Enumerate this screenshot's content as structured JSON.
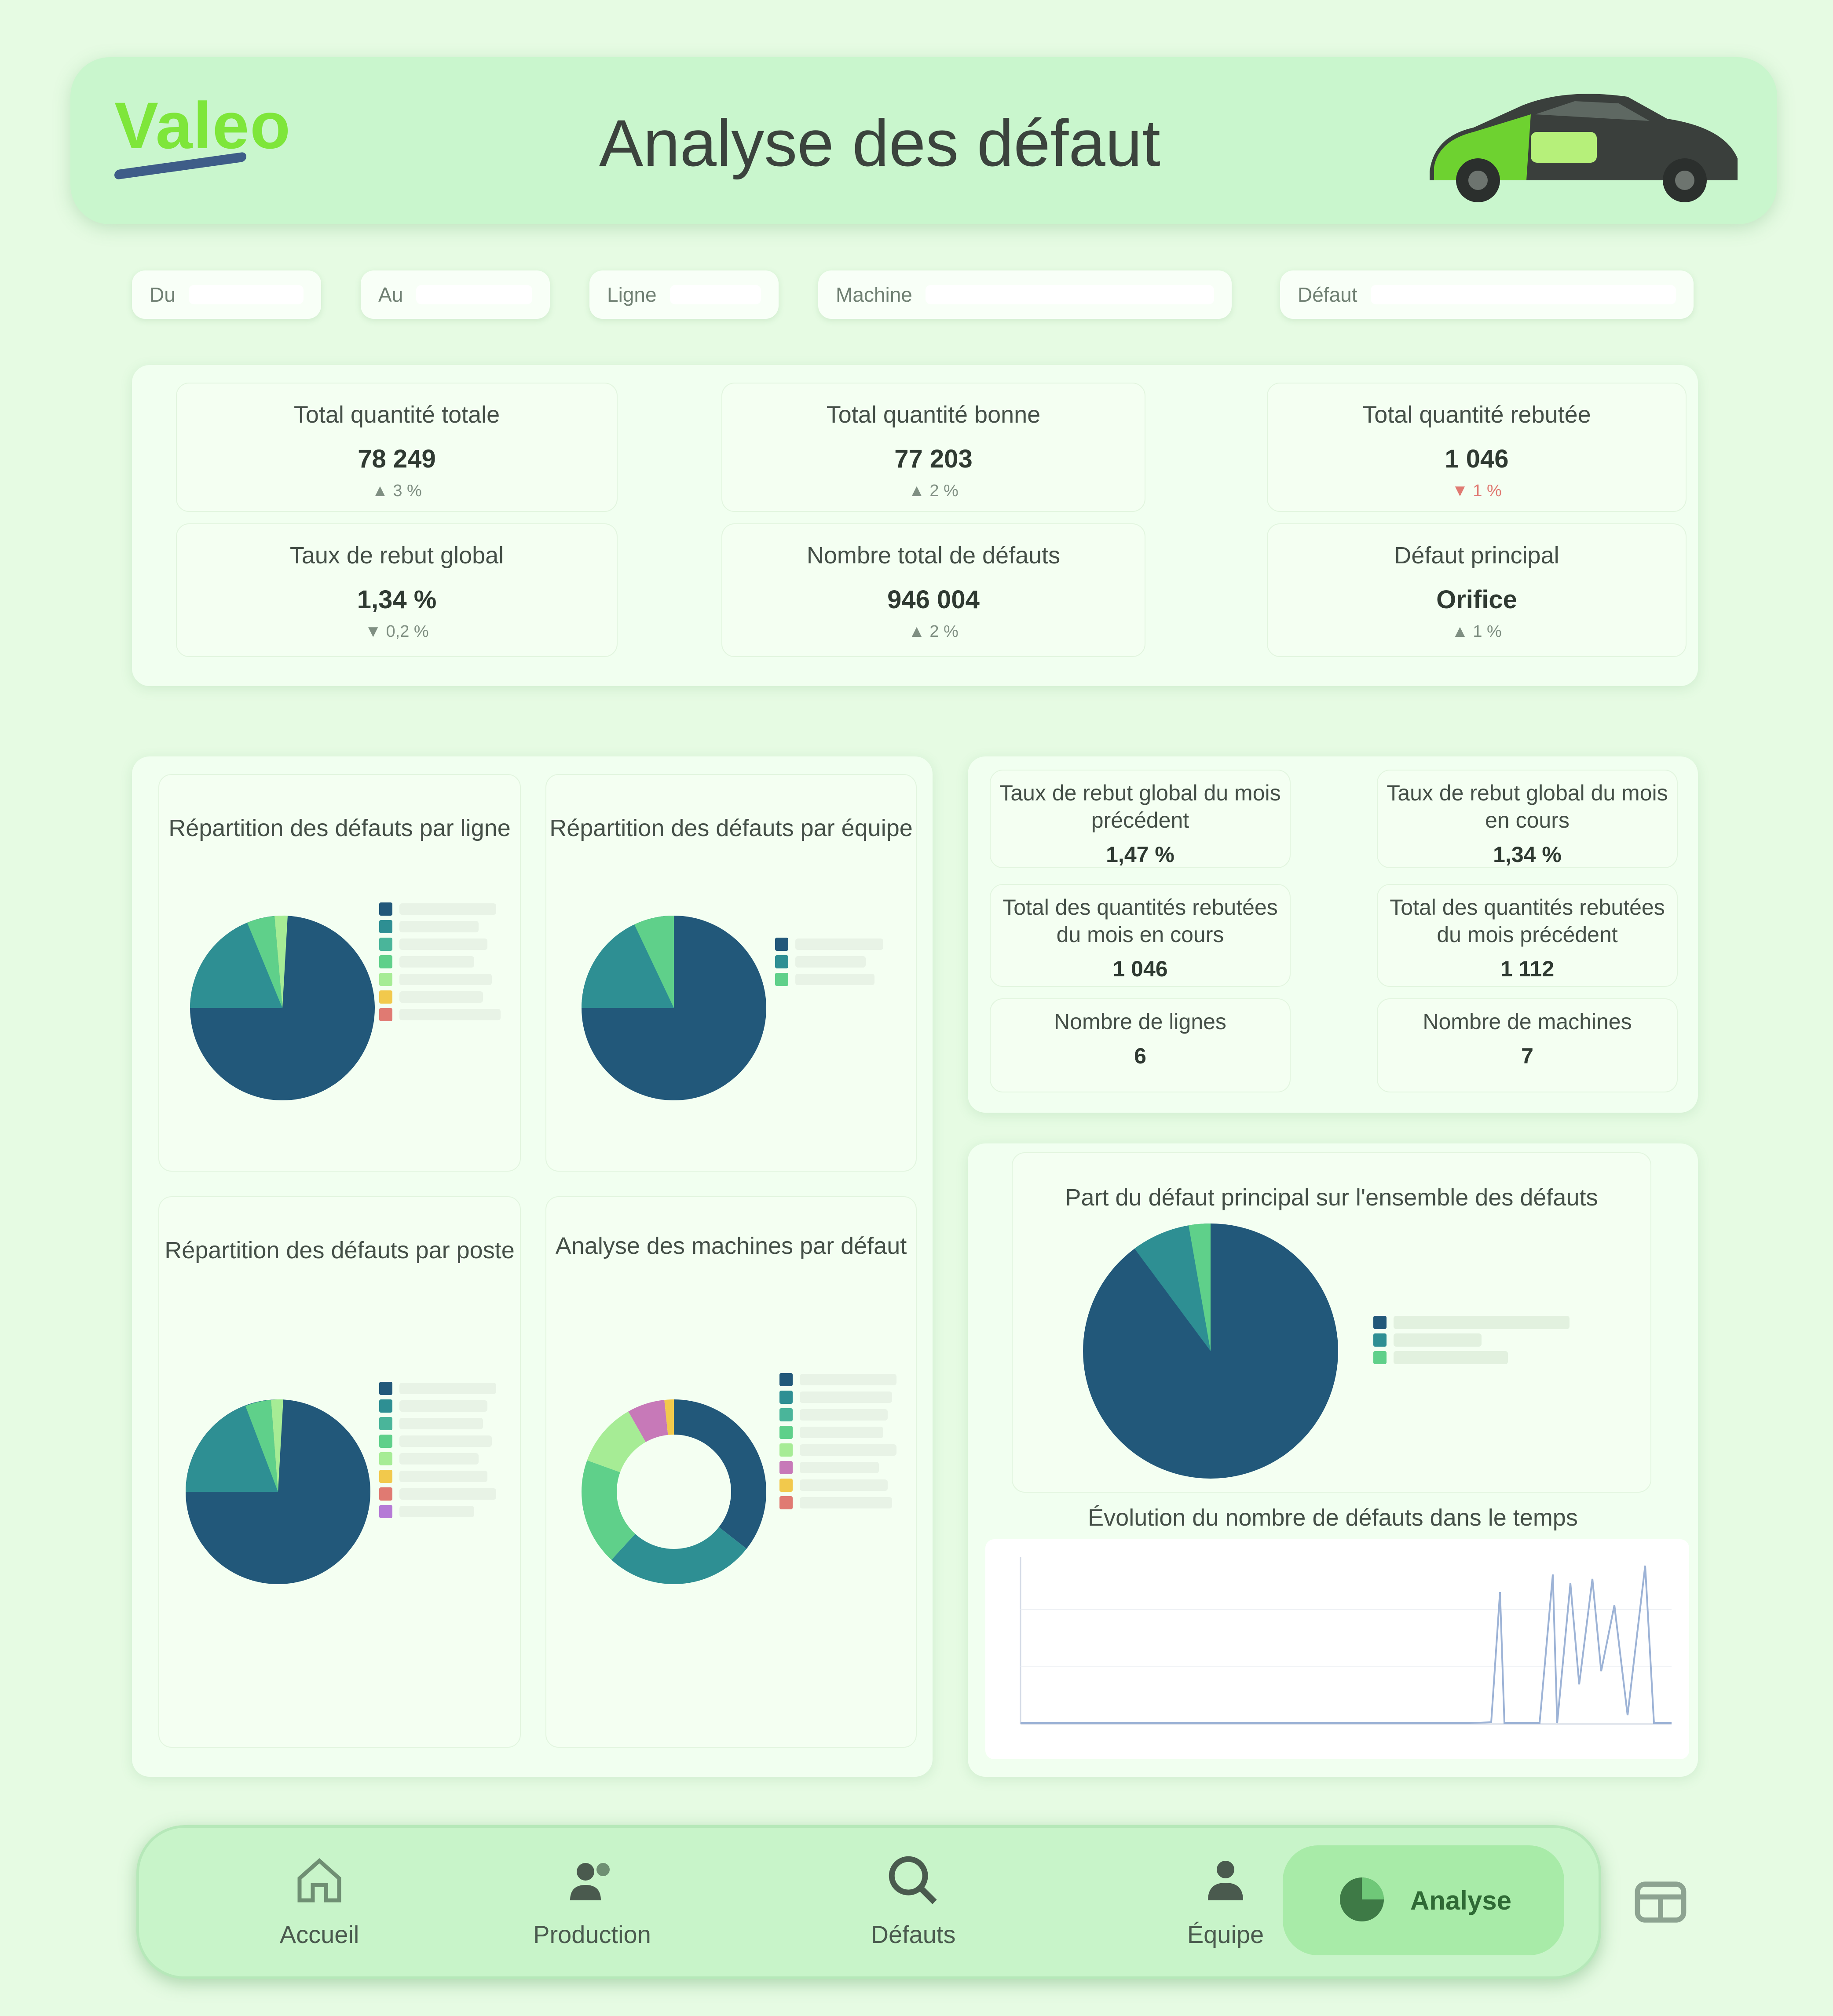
{
  "header": {
    "brand": "Valeo",
    "title": "Analyse des défaut"
  },
  "filters": [
    {
      "label": "Du"
    },
    {
      "label": "Au"
    },
    {
      "label": "Ligne"
    },
    {
      "label": "Machine"
    },
    {
      "label": "Défaut"
    }
  ],
  "kpis": [
    {
      "label": "Total quantité totale",
      "value": "78 249",
      "trend": "▲ 3 %"
    },
    {
      "label": "Total quantité bonne",
      "value": "77 203",
      "trend": "▲ 2 %"
    },
    {
      "label": "Total quantité rebutée",
      "value": "1 046",
      "trend": "▼ 1 %"
    },
    {
      "label": "Taux de rebut global",
      "value": "1,34 %",
      "trend": "▼ 0,2 %"
    },
    {
      "label": "Nombre total de défauts",
      "value": "946 004",
      "trend": "▲ 2 %"
    },
    {
      "label": "Défaut principal",
      "value": "Orifice",
      "trend": "▲ 1 %"
    }
  ],
  "charts": {
    "pie1": {
      "title": "Répartition des défauts par ligne"
    },
    "pie2": {
      "title": "Répartition des défauts par équipe"
    },
    "pie3": {
      "title": "Répartition des défauts par poste"
    },
    "donut": {
      "title": "Analyse des machines par défaut"
    },
    "bigpie": {
      "title": "Part du défaut principal sur l'ensemble des défauts"
    },
    "line": {
      "title": "Évolution du nombre de défauts dans le temps"
    }
  },
  "stats": [
    {
      "label": "Taux de rebut global du mois précédent",
      "value": "1,47 %"
    },
    {
      "label": "Taux de rebut global du mois en cours",
      "value": "1,34 %"
    },
    {
      "label": "Total des quantités rebutées du mois en cours",
      "value": "1 046"
    },
    {
      "label": "Total des quantités rebutées du mois précédent",
      "value": "1 112"
    },
    {
      "label": "Nombre de lignes",
      "value": "6"
    },
    {
      "label": "Nombre de machines",
      "value": "7"
    }
  ],
  "nav": {
    "items": [
      {
        "label": "Accueil",
        "icon": "home-icon"
      },
      {
        "label": "Production",
        "icon": "users-icon"
      },
      {
        "label": "Défauts",
        "icon": "search-icon"
      },
      {
        "label": "Équipe",
        "icon": "team-icon"
      }
    ],
    "active": {
      "label": "Analyse",
      "icon": "chart-icon"
    },
    "extra_icon": "grid-icon"
  },
  "colors": {
    "primary_dark": "#22587a",
    "teal": "#2e8f93",
    "green": "#5fd08a",
    "light_green": "#a6ec95",
    "accent_brand": "#7ee63a"
  }
}
